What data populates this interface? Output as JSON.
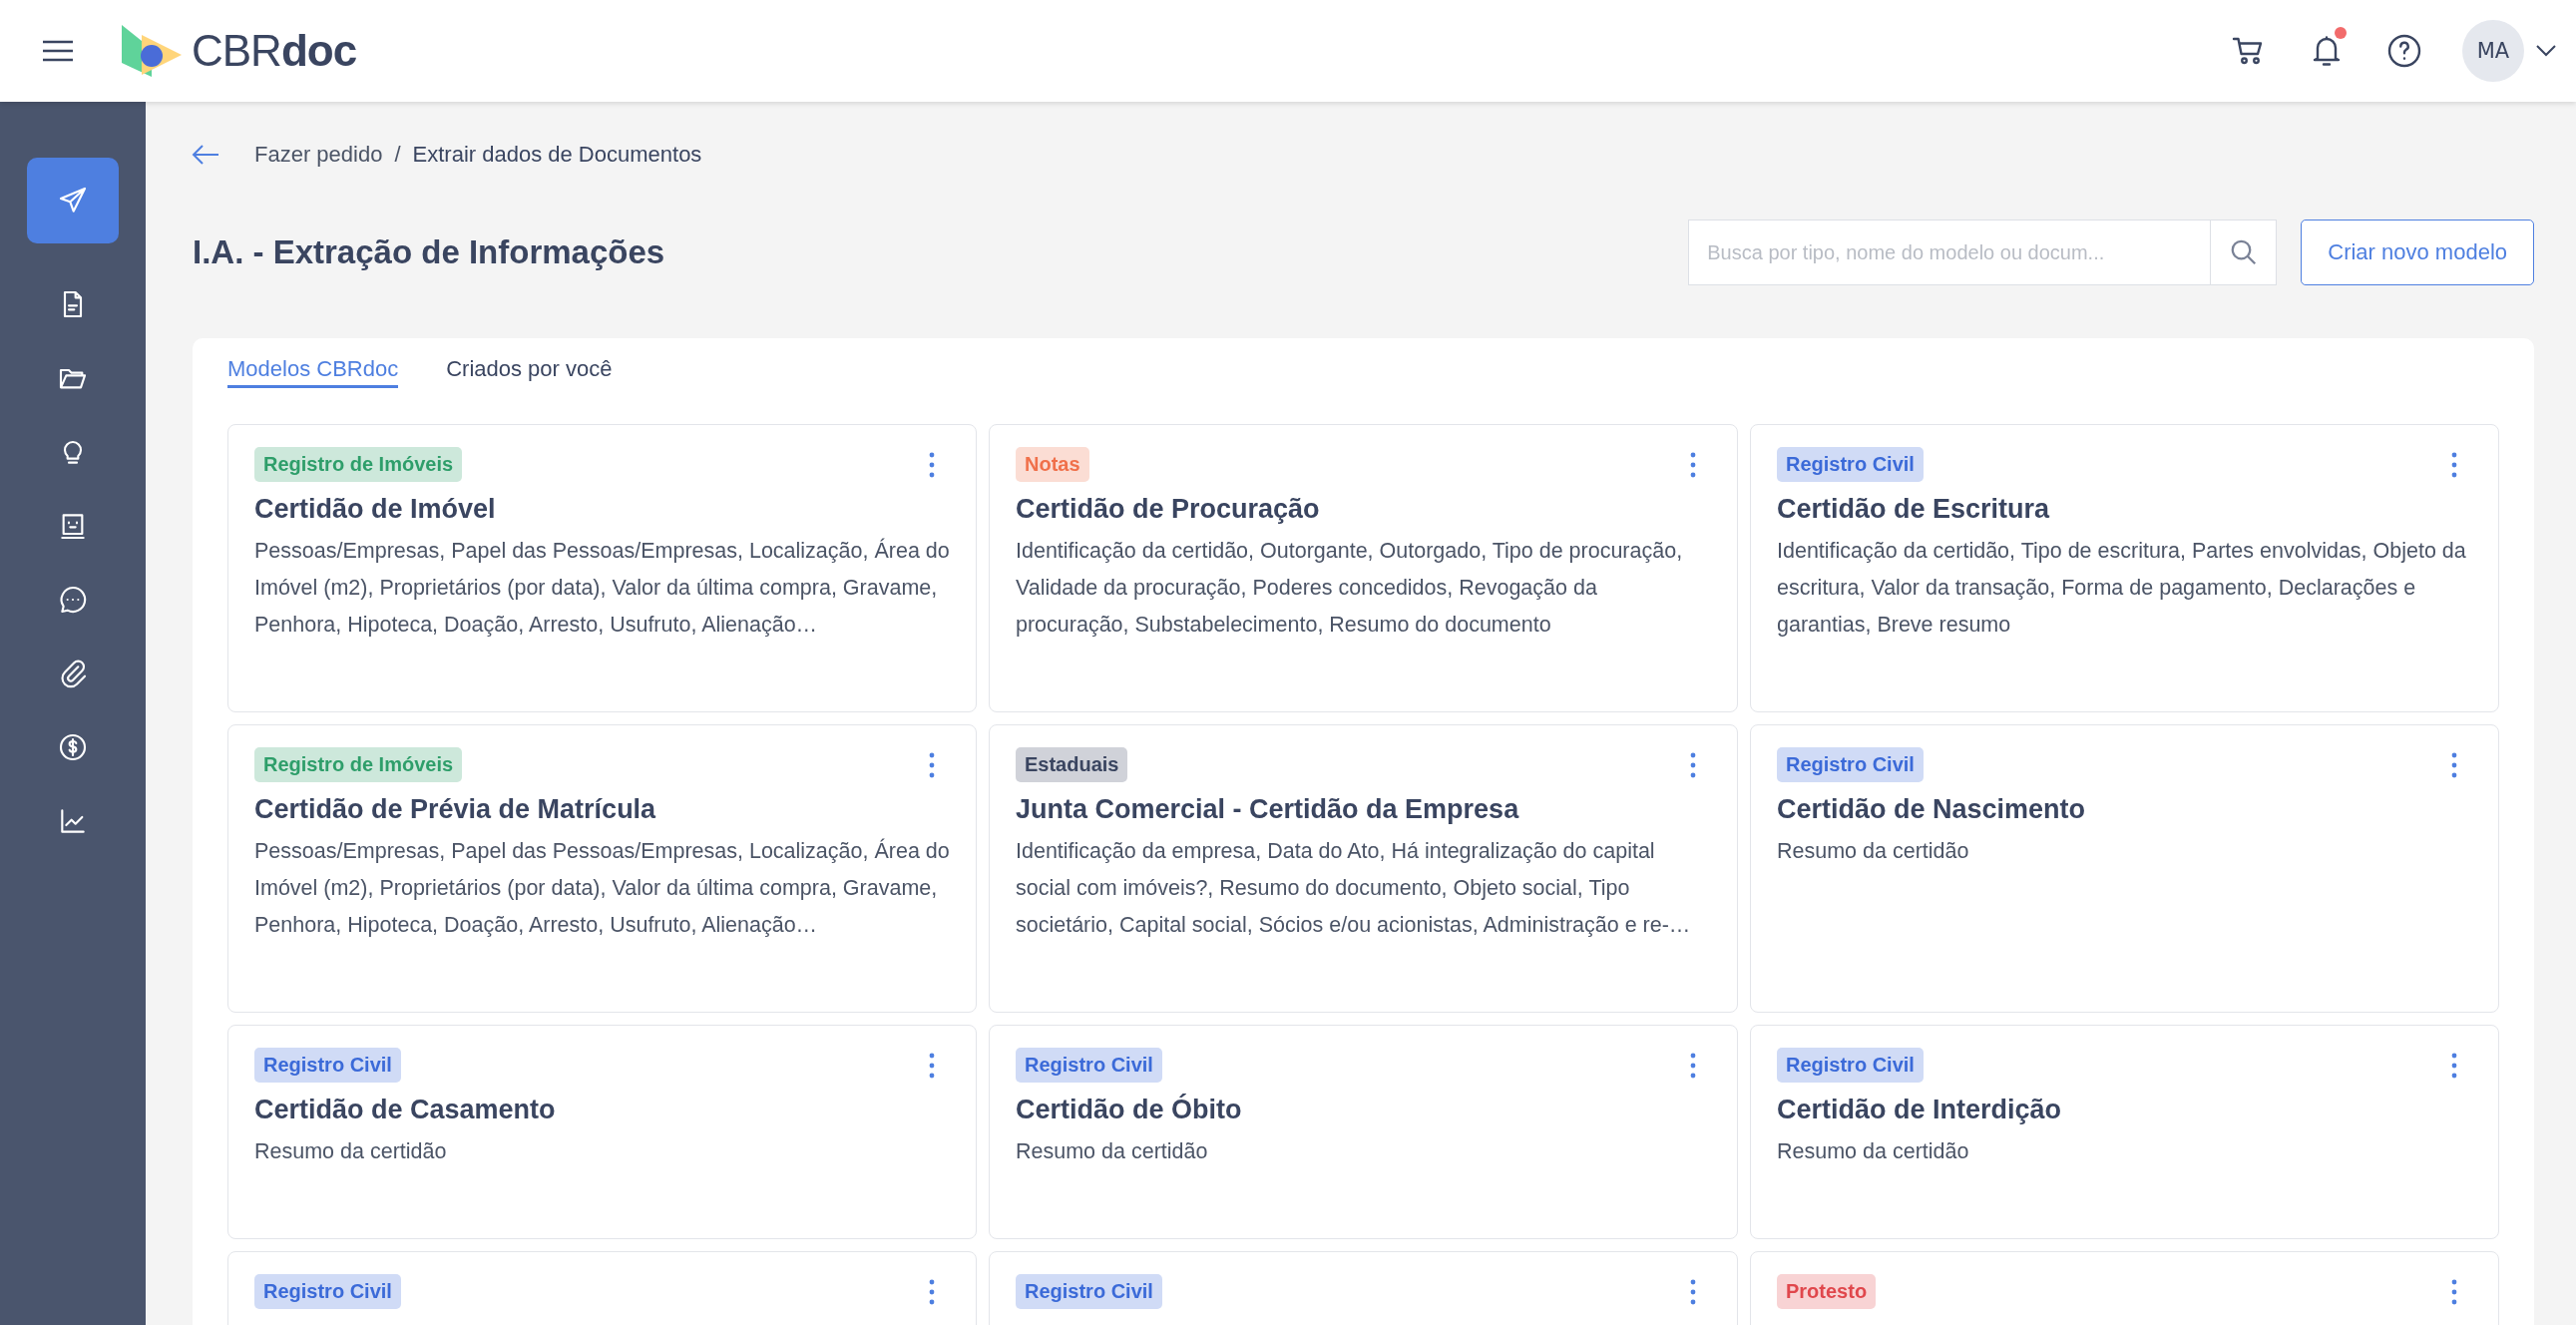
{
  "header": {
    "logo": {
      "light": "CBR",
      "bold": "doc"
    },
    "has_notification": true,
    "avatar": "MA"
  },
  "sidebar": {
    "items": [
      {
        "kind": "send",
        "selected": true
      },
      {
        "kind": "document",
        "selected": false
      },
      {
        "kind": "folder",
        "selected": false
      },
      {
        "kind": "bulb",
        "selected": false
      },
      {
        "kind": "robot",
        "selected": false
      },
      {
        "kind": "chat",
        "selected": false
      },
      {
        "kind": "clip",
        "selected": false
      },
      {
        "kind": "dollar",
        "selected": false
      },
      {
        "kind": "chart",
        "selected": false
      }
    ]
  },
  "breadcrumb": {
    "separator": "/",
    "items": [
      "Fazer pedido",
      "Extrair dados de Documentos"
    ]
  },
  "page_title": "I.A. - Extração de Informações",
  "search": {
    "placeholder": "Busca por tipo, nome do modelo ou docum..."
  },
  "create_button": "Criar novo modelo",
  "tabs": [
    {
      "label": "Modelos CBRdoc",
      "selected": true
    },
    {
      "label": "Criados por você",
      "selected": false
    }
  ],
  "cards": [
    {
      "tag": "Registro de Imóveis",
      "color": "#2e9e6a",
      "title": "Certidão de Imóvel",
      "description": "Pessoas/Empresas, Papel das Pessoas/Empresas, Localização, Área do Imóvel (m2), Proprietários (por data), Valor da última compra, Gravame, Penhora, Hipoteca, Doação, Arresto, Usufruto, Alienação…"
    },
    {
      "tag": "Notas",
      "color": "#f0704a",
      "title": "Certidão de Procuração",
      "description": "Identificação da certidão, Outorgante, Outorgado, Tipo de procuração, Validade da procuração, Poderes concedidos, Revogação da procuração, Substabelecimento, Resumo do documento"
    },
    {
      "tag": "Registro Civil",
      "color": "#3b6ad8",
      "title": "Certidão de Escritura",
      "description": "Identificação da certidão, Tipo de escritura, Partes envolvidas, Objeto da escritura, Valor da transação, Forma de pagamento, Declarações e garantias, Breve resumo"
    },
    {
      "tag": "Registro de Imóveis",
      "color": "#2e9e6a",
      "title": "Certidão de Prévia de Matrícula",
      "description": "Pessoas/Empresas, Papel das Pessoas/Empresas, Localização, Área do Imóvel (m2), Proprietários (por data), Valor da última compra, Gravame, Penhora, Hipoteca, Doação, Arresto, Usufruto, Alienação…"
    },
    {
      "tag": "Estaduais",
      "color": "#3a4560",
      "title": "Junta Comercial - Certidão da Empresa",
      "description": "Identificação da empresa, Data do Ato, Há integralização do capital social com imóveis?, Resumo do documento, Objeto social, Tipo societário, Capital social, Sócios e/ou acionistas, Administração e re-…"
    },
    {
      "tag": "Registro Civil",
      "color": "#3b6ad8",
      "title": "Certidão de Nascimento",
      "description": "Resumo da certidão"
    },
    {
      "tag": "Registro Civil",
      "color": "#3b6ad8",
      "title": "Certidão de Casamento",
      "description": "Resumo da certidão"
    },
    {
      "tag": "Registro Civil",
      "color": "#3b6ad8",
      "title": "Certidão de Óbito",
      "description": "Resumo da certidão"
    },
    {
      "tag": "Registro Civil",
      "color": "#3b6ad8",
      "title": "Certidão de Interdição",
      "description": "Resumo da certidão"
    },
    {
      "tag": "Registro Civil",
      "color": "#3b6ad8"
    },
    {
      "tag": "Registro Civil",
      "color": "#3b6ad8"
    },
    {
      "tag": "Protesto",
      "color": "#e0474c"
    }
  ]
}
